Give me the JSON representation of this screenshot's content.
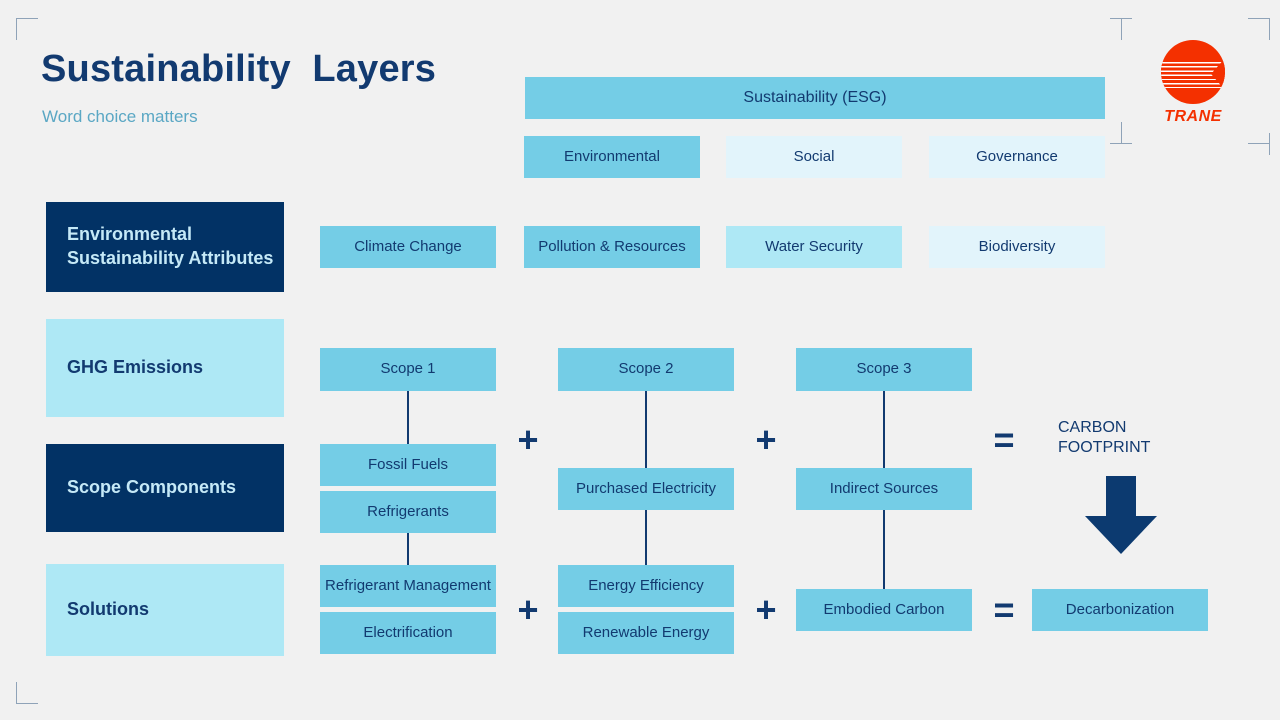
{
  "header": {
    "title": "Sustainability  Layers",
    "subtitle": "Word choice matters",
    "logo_text": "TRANE"
  },
  "esg": {
    "top_bar": "Sustainability (ESG)",
    "pillars": [
      "Environmental",
      "Social",
      "Governance"
    ]
  },
  "rows": {
    "attributes_label": "Environmental Sustainability Attributes",
    "ghg_label": "GHG Emissions",
    "components_label": "Scope Components",
    "solutions_label": "Solutions"
  },
  "attributes": [
    "Climate Change",
    "Pollution & Resources",
    "Water Security",
    "Biodiversity"
  ],
  "scopes": [
    "Scope 1",
    "Scope 2",
    "Scope 3"
  ],
  "components": {
    "scope1": [
      "Fossil Fuels",
      "Refrigerants"
    ],
    "scope2": [
      "Purchased Electricity"
    ],
    "scope3": [
      "Indirect Sources"
    ]
  },
  "solutions": {
    "scope1": [
      "Refrigerant Management",
      "Electrification"
    ],
    "scope2": [
      "Energy Efficiency",
      "Renewable Energy"
    ],
    "scope3": [
      "Embodied Carbon"
    ],
    "result": "Decarbonization"
  },
  "result": {
    "carbon_footprint": "CARBON\nFOOTPRINT"
  },
  "operators": {
    "plus": "+",
    "equals": "="
  },
  "colors": {
    "background": "#f1f1f1",
    "navy": "#023265",
    "text_navy": "#123a70",
    "medium_blue": "#74cde6",
    "light_blue": "#aee8f5",
    "pale_blue": "#e2f4fb",
    "brand_red": "#f43000",
    "subtitle_blue": "#5aa7c4"
  }
}
